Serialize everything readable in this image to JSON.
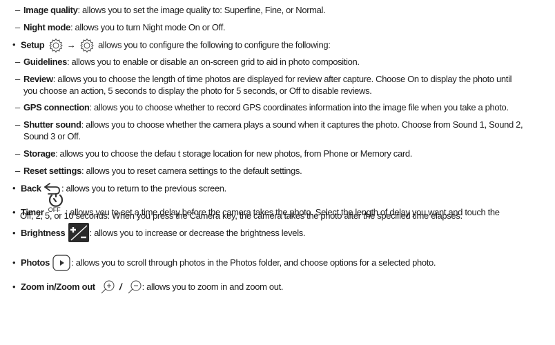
{
  "items": {
    "image_quality": {
      "term": "Image quality",
      "text": ": allows you to set the image quality to: Superfine, Fine, or Normal."
    },
    "night_mode": {
      "term": "Night mode",
      "text": ": allows you to turn Night mode On or Off."
    },
    "setup": {
      "term": "Setup",
      "arrow": "→",
      "text": " allows you to configure the following to configure the following:"
    },
    "guidelines": {
      "term": "Guidelines",
      "text": ": allows you to enable or disable an on-screen grid to aid in photo composition."
    },
    "review": {
      "term": "Review",
      "text1": ": allows you to choose the length of time photos are displayed for review after capture. Choose On to display the photo until",
      "text2": "you choose an action, 5 seconds to display the photo for 5 seconds, or Off to disable reviews."
    },
    "gps": {
      "term": "GPS connection",
      "text": ": allows you to choose whether to record GPS coordinates information into the image file when you take a photo."
    },
    "shutter": {
      "term": "Shutter sound",
      "text1": ": allows you to choose whether the camera plays a sound when it captures the photo. Choose from Sound 1, Sound 2,",
      "text2": "Sound 3 or Off."
    },
    "storage": {
      "term": "Storage",
      "text": ": allows you to choose the defau t storage location for new photos, from Phone or Memory card."
    },
    "reset": {
      "term": "Reset settings",
      "text": ": allows you to reset camera settings to the default settings."
    },
    "back": {
      "term": "Back",
      "text": ": allows you to return to the previous screen."
    },
    "timer": {
      "term": "Timer",
      "icon_label": "OFF",
      "text1": ": allows you to set a time delay before the camera takes the photo. Select the length of delay you want and touch the",
      "text2": "Off, 2, 5, or 10 seconds. When you press the Camera key, the camera takes the photo after the specified time elapses."
    },
    "brightness": {
      "term": "Brightness",
      "text": ": allows you to increase or decrease the brightness levels."
    },
    "photos": {
      "term": "Photos",
      "text": ": allows you to scroll through photos in the Photos folder, and choose options for a selected photo."
    },
    "zoom": {
      "term": "Zoom in/Zoom out",
      "separator": "/",
      "text": ": allows you to zoom in and zoom out."
    }
  },
  "symbols": {
    "dash": "–",
    "bullet": "•"
  },
  "icons": [
    "gear-icon",
    "back-arrow-icon",
    "timer-icon",
    "brightness-icon",
    "play-icon",
    "zoom-in-icon",
    "zoom-out-icon"
  ]
}
